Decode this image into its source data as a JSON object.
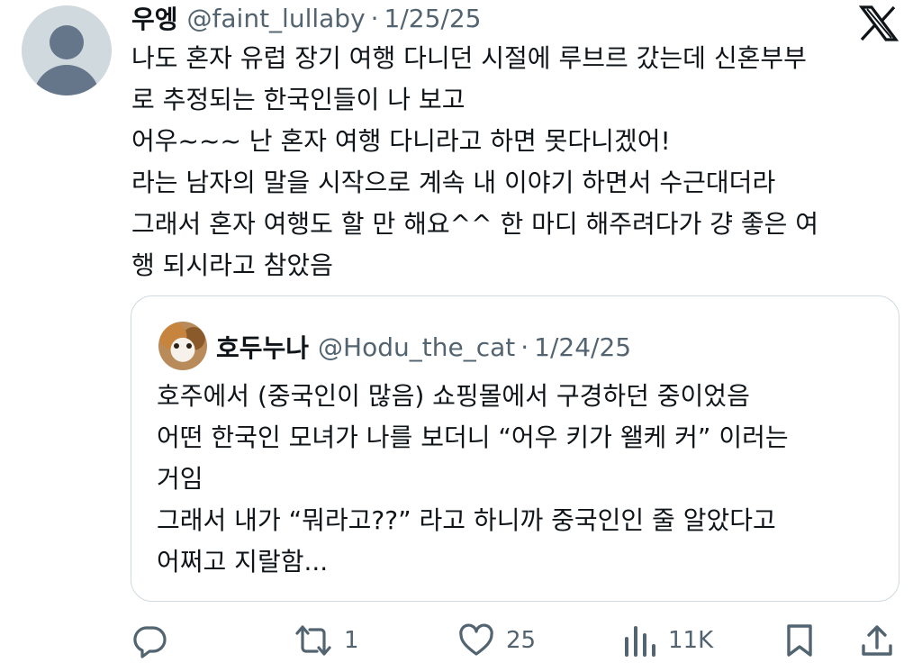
{
  "tweet": {
    "author_name": "우엥",
    "handle": "@faint_lullaby",
    "separator": "·",
    "date": "1/25/25",
    "lines": [
      "나도 혼자 유럽 장기 여행 다니던 시절에 루브르 갔는데 신혼부부",
      "로 추정되는 한국인들이 나 보고",
      "어우~~~ 난 혼자 여행 다니라고 하면 못다니겠어!",
      "라는 남자의 말을 시작으로 계속 내 이야기 하면서 수근대더라",
      "그래서 혼자 여행도 할 만 해요^^ 한 마디 해주려다가 걍 좋은 여",
      "행 되시라고 참았음"
    ]
  },
  "quoted": {
    "author_name": "호두누나",
    "handle": "@Hodu_the_cat",
    "separator": "·",
    "date": "1/24/25",
    "lines": [
      "호주에서 (중국인이 많음) 쇼핑몰에서 구경하던 중이었음",
      "어떤 한국인 모녀가 나를 보더니 “어우 키가 왤케 커” 이러는",
      "거임",
      "그래서 내가 “뭐라고??” 라고 하니까 중국인인 줄 알았다고",
      "어쩌고 지랄함..."
    ]
  },
  "actions": {
    "reply_count": "",
    "repost_count": "1",
    "like_count": "25",
    "views_count": "11K"
  },
  "icons": {
    "brand": "x-logo-icon",
    "reply": "reply-icon",
    "repost": "repost-icon",
    "like": "heart-icon",
    "views": "views-icon",
    "bookmark": "bookmark-icon",
    "share": "share-icon"
  },
  "colors": {
    "text": "#0f1419",
    "meta": "#536471",
    "border": "#cfd9de",
    "avatar_bg": "#cfd9de",
    "avatar_fg": "#65768a"
  }
}
